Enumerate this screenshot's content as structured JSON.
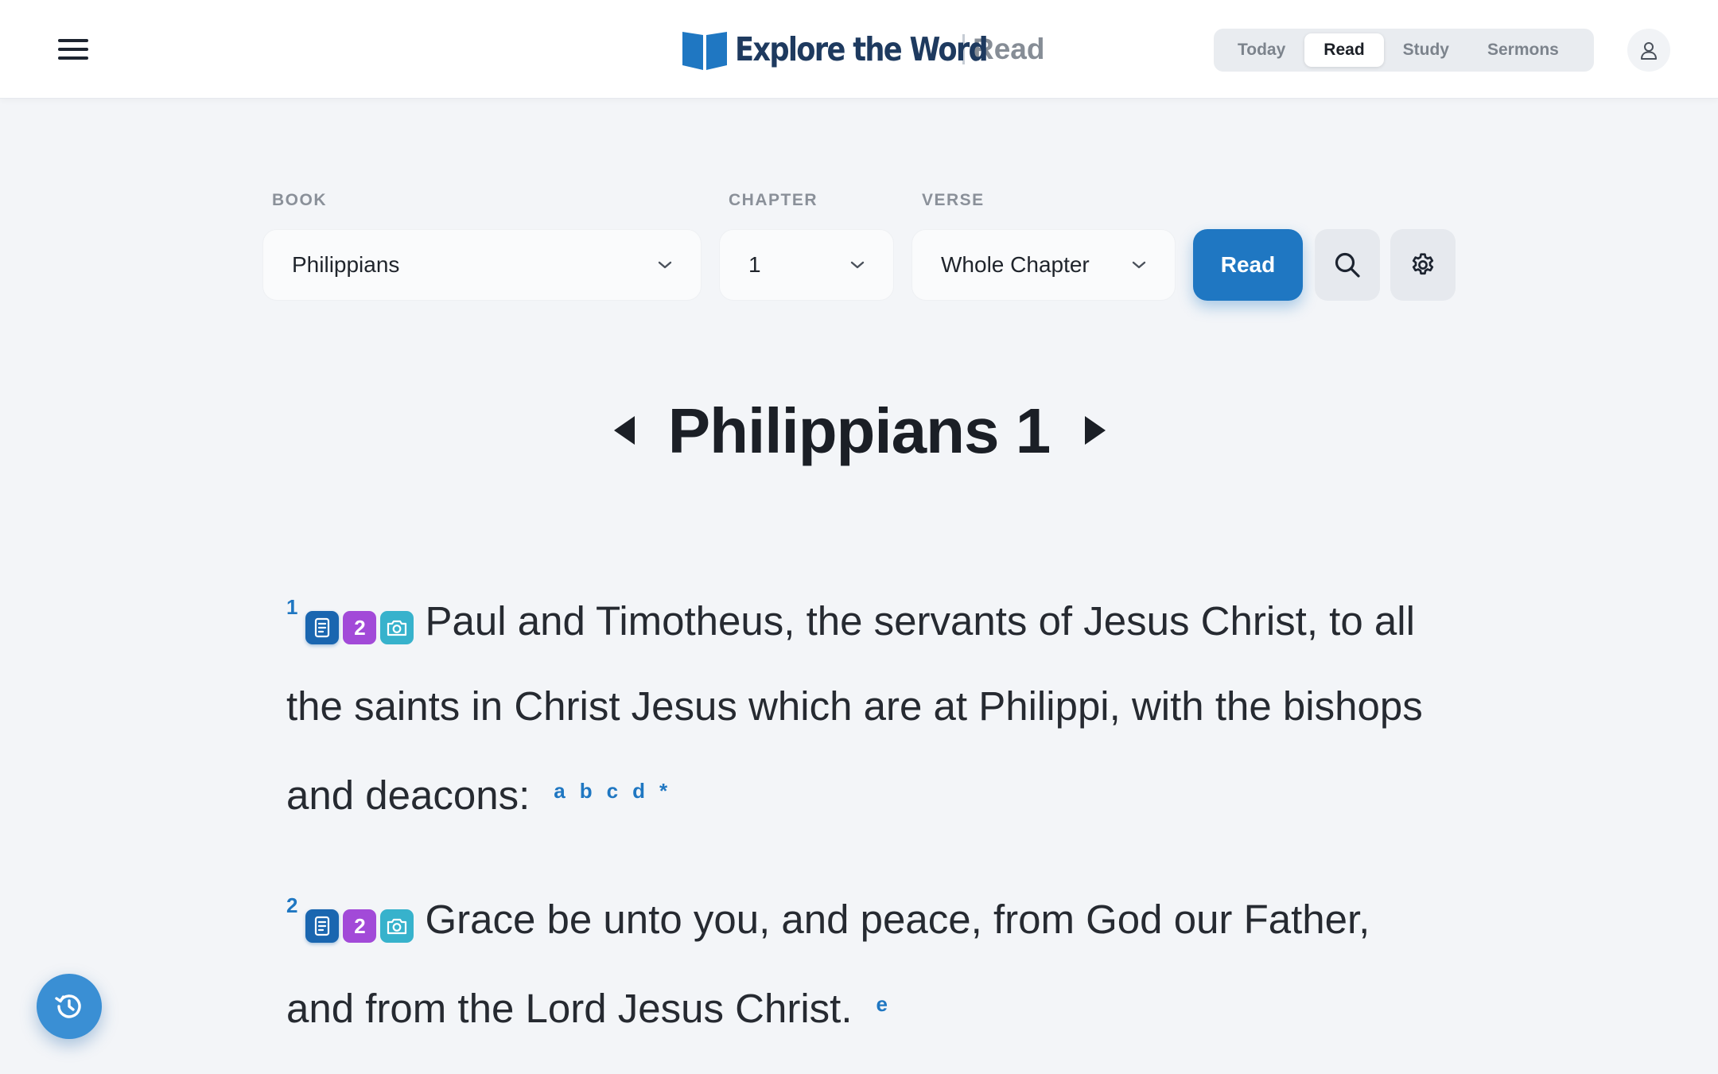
{
  "header": {
    "brand_name": "Explore the Word",
    "section": "Read",
    "tabs": [
      {
        "label": "Today"
      },
      {
        "label": "Read",
        "active": true
      },
      {
        "label": "Study"
      },
      {
        "label": "Sermons"
      }
    ]
  },
  "selector": {
    "book_label": "BOOK",
    "book_value": "Philippians",
    "chapter_label": "CHAPTER",
    "chapter_value": "1",
    "verse_label": "VERSE",
    "verse_value": "Whole Chapter",
    "read_label": "Read"
  },
  "chapter": {
    "title": "Philippians 1",
    "verses": [
      {
        "number": "1",
        "resource_count": "2",
        "text": "Paul and Timotheus, the servants of Jesus Christ, to all the saints in Christ Jesus which are at Philippi, with the bishops and deacons:",
        "footnotes": [
          "a",
          "b",
          "c",
          "d",
          "*"
        ]
      },
      {
        "number": "2",
        "resource_count": "2",
        "text": "Grace be unto you, and peace, from God our Father, and from the Lord Jesus Christ.",
        "footnotes": [
          "e"
        ]
      }
    ]
  },
  "colors": {
    "accent": "#1f77c2",
    "brand_text": "#1e3a5f",
    "note_badge": "#1a66b0",
    "count_badge": "#a24ad8",
    "camera_badge": "#37b2cc",
    "background": "#f3f5f8"
  },
  "icons": {
    "menu": "hamburger-menu-icon",
    "logo": "open-book-icon",
    "user": "user-icon",
    "search": "search-icon",
    "settings": "gear-icon",
    "prev": "triangle-left-icon",
    "next": "triangle-right-icon",
    "note": "document-icon",
    "camera": "camera-icon",
    "history": "history-icon"
  }
}
